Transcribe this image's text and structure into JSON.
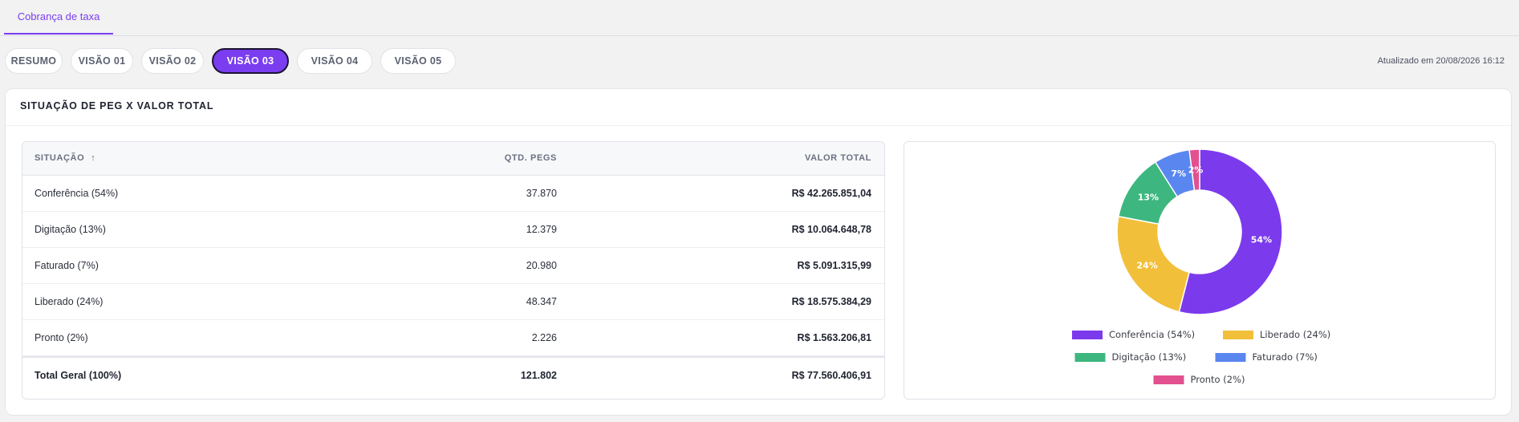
{
  "top_tab": {
    "label": "Cobrança de taxa"
  },
  "pills": [
    {
      "label": "RESUMO",
      "active": false
    },
    {
      "label": "VISÃO 01",
      "active": false
    },
    {
      "label": "VISÃO 02",
      "active": false
    },
    {
      "label": "VISÃO 03",
      "active": true
    },
    {
      "label": "VISÃO 04",
      "active": false
    },
    {
      "label": "VISÃO 05",
      "active": false
    }
  ],
  "updated_text": "Atualizado em 20/08/2026 16:12",
  "card": {
    "title": "SITUAÇÃO DE PEG X VALOR TOTAL"
  },
  "table": {
    "headers": [
      "SITUAÇÃO",
      "QTD. PEGS",
      "VALOR TOTAL"
    ],
    "sort_icon": "arrow-up-icon",
    "rows": [
      {
        "situacao": "Conferência (54%)",
        "qtd": "37.870",
        "valor": "R$ 42.265.851,04"
      },
      {
        "situacao": "Digitação (13%)",
        "qtd": "12.379",
        "valor": "R$ 10.064.648,78"
      },
      {
        "situacao": "Faturado (7%)",
        "qtd": "20.980",
        "valor": "R$ 5.091.315,99"
      },
      {
        "situacao": "Liberado (24%)",
        "qtd": "48.347",
        "valor": "R$ 18.575.384,29"
      },
      {
        "situacao": "Pronto (2%)",
        "qtd": "2.226",
        "valor": "R$ 1.563.206,81"
      }
    ],
    "total": {
      "situacao": "Total Geral (100%)",
      "qtd": "121.802",
      "valor": "R$ 77.560.406,91"
    }
  },
  "chart_data": {
    "type": "pie",
    "donut": true,
    "categories": [
      "Conferência",
      "Liberado",
      "Digitação",
      "Faturado",
      "Pronto"
    ],
    "values": [
      54,
      24,
      13,
      7,
      2
    ],
    "labels": [
      "54%",
      "24%",
      "13%",
      "7%",
      "2%"
    ],
    "legend": [
      "Conferência (54%)",
      "Liberado (24%)",
      "Digitação (13%)",
      "Faturado (7%)",
      "Pronto (2%)"
    ],
    "colors": [
      "#7c3aed",
      "#f2bf3a",
      "#3db77f",
      "#5a86f0",
      "#e2508f"
    ],
    "legend_placement": "bottom"
  },
  "colors": {
    "accent": "#7b3df0",
    "active_pill_border": "#1c1333"
  }
}
